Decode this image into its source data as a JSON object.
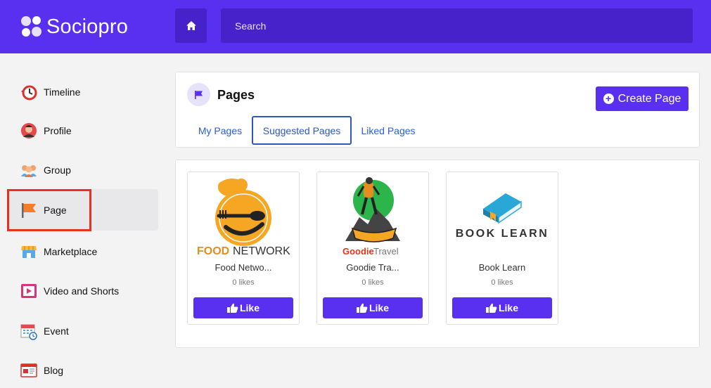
{
  "app": {
    "name": "Sociopro"
  },
  "header": {
    "search_placeholder": "Search"
  },
  "sidebar": {
    "items": [
      {
        "label": "Timeline",
        "icon": "timeline-clock-icon"
      },
      {
        "label": "Profile",
        "icon": "profile-avatar-icon"
      },
      {
        "label": "Group",
        "icon": "group-people-icon"
      },
      {
        "label": "Page",
        "icon": "page-flag-icon",
        "active": true
      },
      {
        "label": "Marketplace",
        "icon": "marketplace-store-icon"
      },
      {
        "label": "Video and Shorts",
        "icon": "video-play-icon"
      },
      {
        "label": "Event",
        "icon": "event-calendar-icon"
      },
      {
        "label": "Blog",
        "icon": "blog-icon"
      }
    ]
  },
  "pages": {
    "title": "Pages",
    "create_label": "Create Page",
    "tabs": [
      {
        "label": "My Pages"
      },
      {
        "label": "Suggested Pages",
        "active": true
      },
      {
        "label": "Liked Pages"
      }
    ]
  },
  "suggested": [
    {
      "name": "Food Netwo...",
      "likes": "0 likes",
      "like_label": "Like",
      "logo_text_1": "FOOD",
      "logo_text_2": " NETWORK"
    },
    {
      "name": "Goodie Tra...",
      "likes": "0 likes",
      "like_label": "Like",
      "logo_text_1": "Goodie",
      "logo_text_2": " Travel"
    },
    {
      "name": "Book Learn",
      "likes": "0 likes",
      "like_label": "Like",
      "logo_text_1": "BOOK LEARN"
    }
  ],
  "colors": {
    "primary": "#5a30f0",
    "primary_dark": "#4522c9",
    "link": "#2a5fd6",
    "active_outline": "#e8321e"
  }
}
